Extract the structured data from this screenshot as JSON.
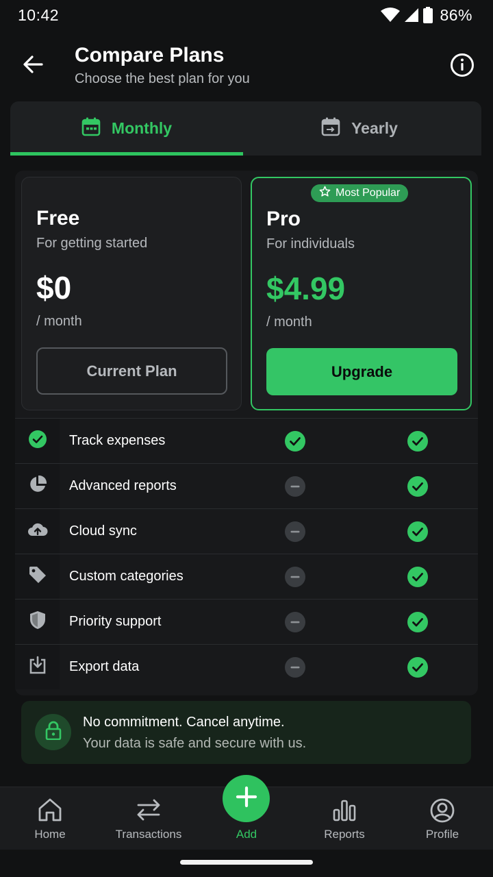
{
  "status_bar": {
    "time": "10:42",
    "battery": "86%"
  },
  "header": {
    "title": "Compare Plans",
    "subtitle": "Choose the best plan for you"
  },
  "tabs": [
    {
      "label": "Monthly",
      "selected": true
    },
    {
      "label": "Yearly",
      "selected": false
    }
  ],
  "plans": {
    "free": {
      "name": "Free",
      "description": "For getting started",
      "price": "$0",
      "period": "/ month",
      "button": "Current Plan"
    },
    "pro": {
      "badge": "Most Popular",
      "name": "Pro",
      "description": "For individuals",
      "price": "$4.99",
      "period": "/ month",
      "button": "Upgrade"
    }
  },
  "features": [
    {
      "label": "Track expenses",
      "icon": "check-circle-icon",
      "free": true,
      "pro": true
    },
    {
      "label": "Advanced reports",
      "icon": "pie-chart-icon",
      "free": false,
      "pro": true
    },
    {
      "label": "Cloud sync",
      "icon": "cloud-upload-icon",
      "free": false,
      "pro": true
    },
    {
      "label": "Custom categories",
      "icon": "tag-icon",
      "free": false,
      "pro": true
    },
    {
      "label": "Priority support",
      "icon": "shield-icon",
      "free": false,
      "pro": true
    },
    {
      "label": "Export data",
      "icon": "download-icon",
      "free": false,
      "pro": true
    }
  ],
  "notice": {
    "title": "No commitment. Cancel anytime.",
    "subtitle": "Your data is safe and secure with us."
  },
  "bottom_nav": [
    {
      "label": "Home",
      "icon": "home-icon"
    },
    {
      "label": "Transactions",
      "icon": "transfer-icon"
    },
    {
      "label": "Add",
      "icon": "plus-icon",
      "active": true
    },
    {
      "label": "Reports",
      "icon": "bar-chart-icon"
    },
    {
      "label": "Profile",
      "icon": "profile-icon"
    }
  ],
  "colors": {
    "accent": "#33c763",
    "background": "#111213",
    "card": "#18191b",
    "muted_text": "#b5b8bc"
  }
}
